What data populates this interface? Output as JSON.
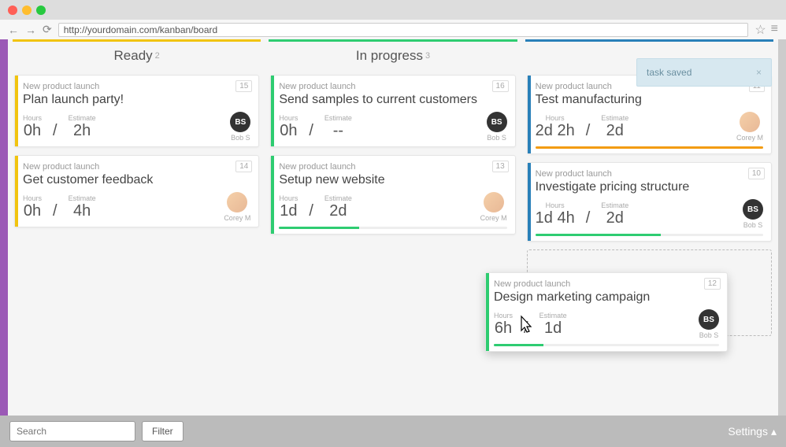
{
  "browser": {
    "url": "http://yourdomain.com/kanban/board"
  },
  "toast": {
    "message": "task saved",
    "close": "×"
  },
  "columns": [
    {
      "title": "Ready",
      "count": "2",
      "color": "yellow",
      "cards": [
        {
          "project": "New product launch",
          "title": "Plan launch party!",
          "num": "15",
          "hours_label": "Hours",
          "hours": "0h",
          "estimate_label": "Estimate",
          "estimate": "2h",
          "assignee": "Bob S",
          "initials": "BS",
          "photo": false,
          "stripe": "yellow",
          "progress": null
        },
        {
          "project": "New product launch",
          "title": "Get customer feedback",
          "num": "14",
          "hours_label": "Hours",
          "hours": "0h",
          "estimate_label": "Estimate",
          "estimate": "4h",
          "assignee": "Corey M",
          "initials": "",
          "photo": true,
          "stripe": "yellow",
          "progress": null
        }
      ]
    },
    {
      "title": "In progress",
      "count": "3",
      "color": "green",
      "cards": [
        {
          "project": "New product launch",
          "title": "Send samples to current customers",
          "num": "16",
          "hours_label": "Hours",
          "hours": "0h",
          "estimate_label": "Estimate",
          "estimate": "--",
          "assignee": "Bob S",
          "initials": "BS",
          "photo": false,
          "stripe": "green",
          "progress": null
        },
        {
          "project": "New product launch",
          "title": "Setup new website",
          "num": "13",
          "hours_label": "Hours",
          "hours": "1d",
          "estimate_label": "Estimate",
          "estimate": "2d",
          "assignee": "Corey M",
          "initials": "",
          "photo": true,
          "stripe": "green",
          "progress": {
            "color": "green",
            "pct": 35
          }
        }
      ]
    },
    {
      "title": "",
      "count": "",
      "color": "blue",
      "cards": [
        {
          "project": "New product launch",
          "title": "Test manufacturing",
          "num": "11",
          "hours_label": "Hours",
          "hours": "2d 2h",
          "estimate_label": "Estimate",
          "estimate": "2d",
          "assignee": "Corey M",
          "initials": "",
          "photo": true,
          "stripe": "blue",
          "progress": {
            "color": "orange",
            "pct": 100
          }
        },
        {
          "project": "New product launch",
          "title": "Investigate pricing structure",
          "num": "10",
          "hours_label": "Hours",
          "hours": "1d 4h",
          "estimate_label": "Estimate",
          "estimate": "2d",
          "assignee": "Bob S",
          "initials": "BS",
          "photo": false,
          "stripe": "blue",
          "progress": {
            "color": "green",
            "pct": 55
          }
        }
      ]
    }
  ],
  "dragging_card": {
    "project": "New product launch",
    "title": "Design marketing campaign",
    "num": "12",
    "hours_label": "Hours",
    "hours": "6h",
    "estimate_label": "Estimate",
    "estimate": "1d",
    "assignee": "Bob S",
    "initials": "BS",
    "stripe": "green",
    "progress": {
      "color": "green",
      "pct": 22
    }
  },
  "footer": {
    "search_placeholder": "Search",
    "filter_label": "Filter",
    "settings_label": "Settings"
  }
}
